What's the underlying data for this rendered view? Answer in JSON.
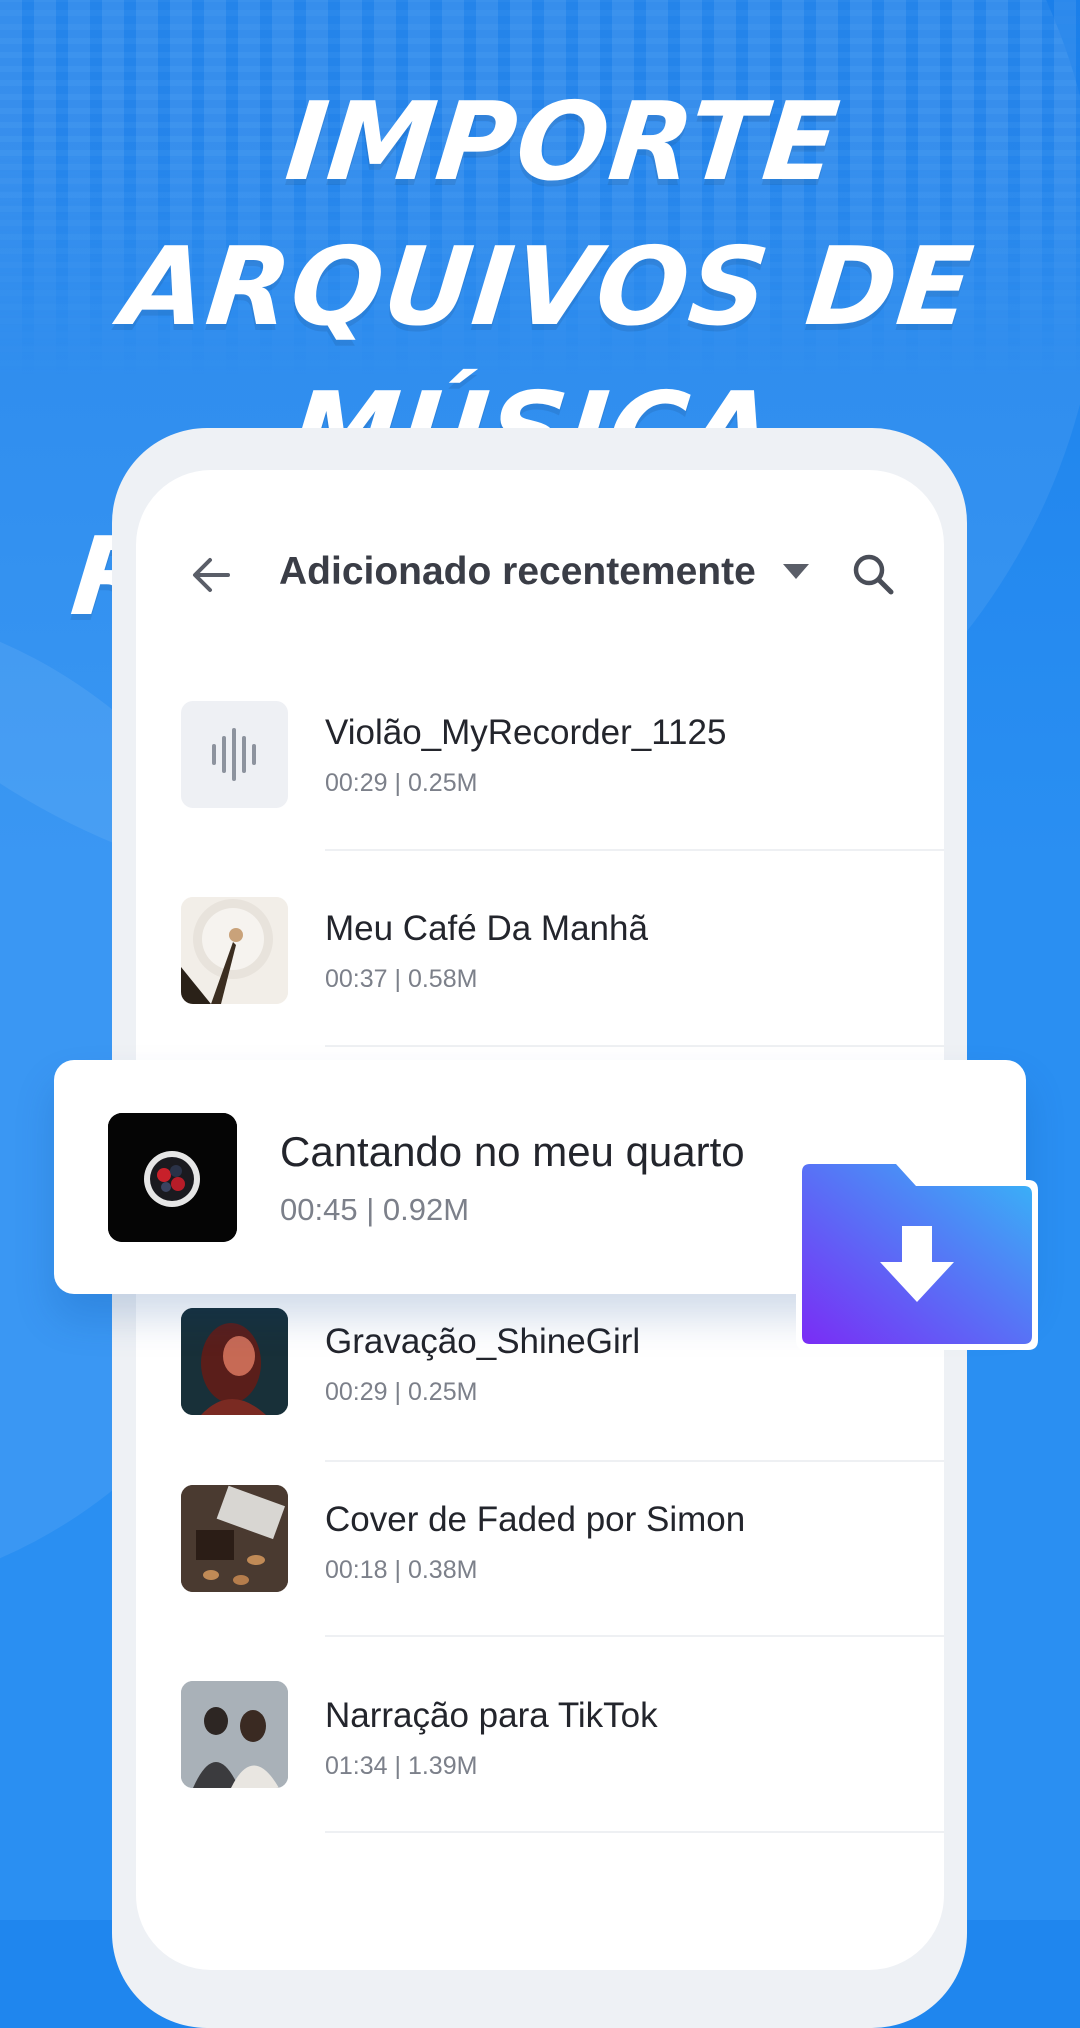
{
  "headline": {
    "line1": "IMPORTE ARQUIVOS DE",
    "line2": "MÚSICA RAPIDAMENTE"
  },
  "header": {
    "title": "Adicionado recentemente",
    "back_icon": "arrow-left-icon",
    "dropdown_icon": "caret-down-icon",
    "search_icon": "search-icon"
  },
  "items": [
    {
      "name": "Violão_MyRecorder_1125",
      "meta": "00:29 | 0.25M",
      "thumb": "waveform-icon"
    },
    {
      "name": "Meu Café Da Manhã",
      "meta": "00:37 | 0.58M",
      "thumb": "coffee-photo"
    },
    {
      "name": "Gravação_ShineGirl",
      "meta": "00:29 | 0.25M",
      "thumb": "girl-photo"
    },
    {
      "name": "Cover de Faded por Simon",
      "meta": "00:18 | 0.38M",
      "thumb": "brownie-photo"
    },
    {
      "name": "Narração para TikTok",
      "meta": "01:34 | 1.39M",
      "thumb": "people-photo"
    }
  ],
  "highlight": {
    "name": "Cantando no meu quarto",
    "meta": "00:45 | 0.92M",
    "thumb": "berries-bowl-photo"
  },
  "folder_icon": "folder-download-icon",
  "colors": {
    "background": "#1f86ee",
    "folder_start": "#7a2cf5",
    "folder_end": "#36b7f7"
  }
}
